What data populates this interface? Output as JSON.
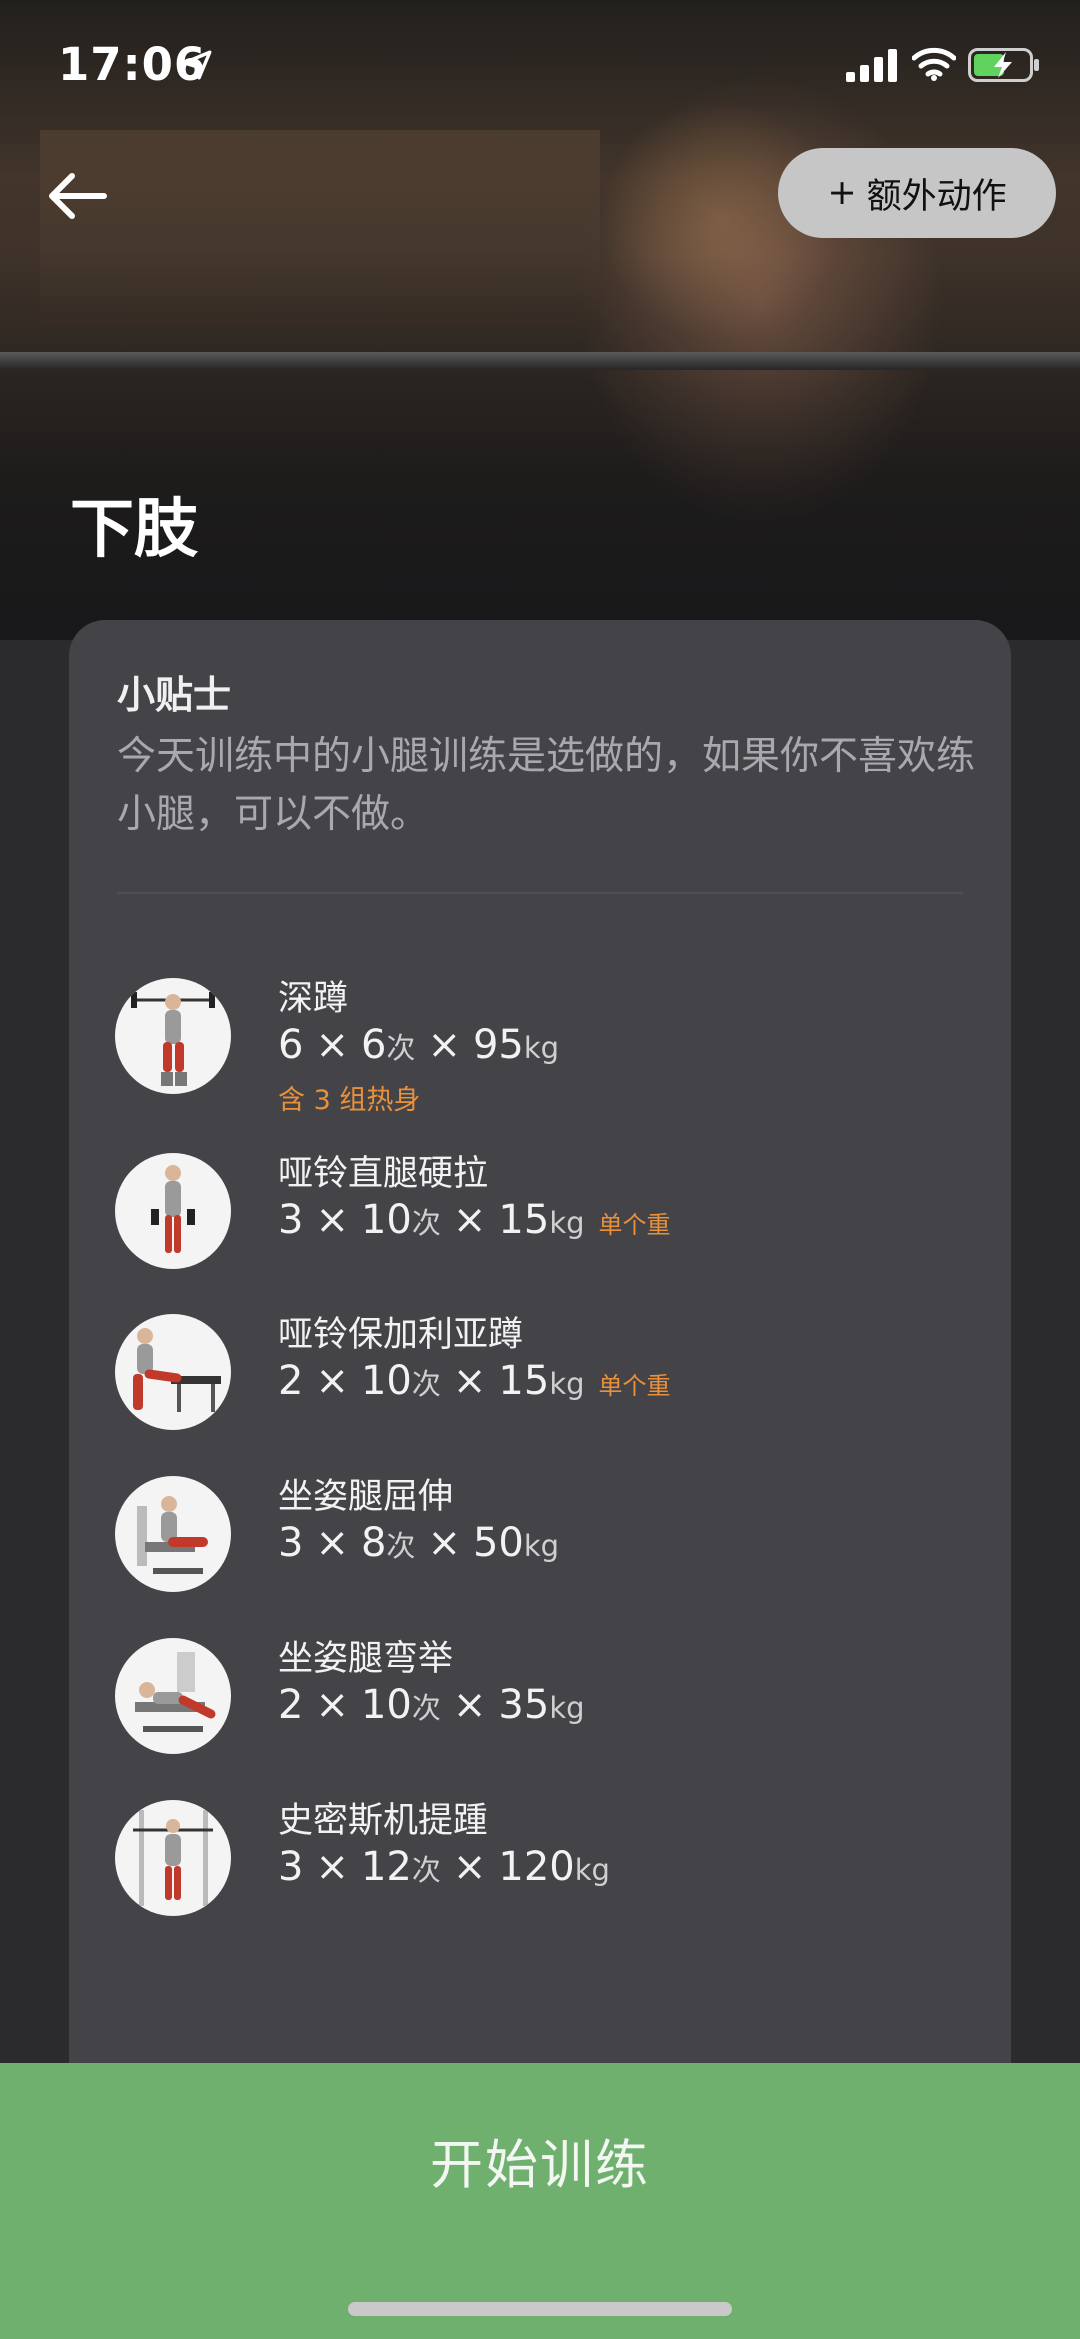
{
  "status_bar": {
    "time": "17:06"
  },
  "header": {
    "extra_label": "额外动作",
    "extra_plus": "+",
    "title": "下肢"
  },
  "tip": {
    "title": "小贴士",
    "text": "今天训练中的小腿训练是选做的，如果你不喜欢练小腿，可以不做。"
  },
  "exercises": [
    {
      "name": "深蹲",
      "sets": "6",
      "reps": "6",
      "reps_unit": "次",
      "weight": "95",
      "weight_unit": "kg",
      "note": "",
      "sub": "含 3 组热身"
    },
    {
      "name": "哑铃直腿硬拉",
      "sets": "3",
      "reps": "10",
      "reps_unit": "次",
      "weight": "15",
      "weight_unit": "kg",
      "note": "单个重",
      "sub": ""
    },
    {
      "name": "哑铃保加利亚蹲",
      "sets": "2",
      "reps": "10",
      "reps_unit": "次",
      "weight": "15",
      "weight_unit": "kg",
      "note": "单个重",
      "sub": ""
    },
    {
      "name": "坐姿腿屈伸",
      "sets": "3",
      "reps": "8",
      "reps_unit": "次",
      "weight": "50",
      "weight_unit": "kg",
      "note": "",
      "sub": ""
    },
    {
      "name": "坐姿腿弯举",
      "sets": "2",
      "reps": "10",
      "reps_unit": "次",
      "weight": "35",
      "weight_unit": "kg",
      "note": "",
      "sub": ""
    },
    {
      "name": "史密斯机提踵",
      "sets": "3",
      "reps": "12",
      "reps_unit": "次",
      "weight": "120",
      "weight_unit": "kg",
      "note": "",
      "sub": ""
    }
  ],
  "symbols": {
    "times": "×"
  },
  "footer": {
    "start_label": "开始训练"
  },
  "colors": {
    "accent_green": "#70b06e",
    "warning_orange": "#e9913a",
    "card_bg": "#444448"
  }
}
